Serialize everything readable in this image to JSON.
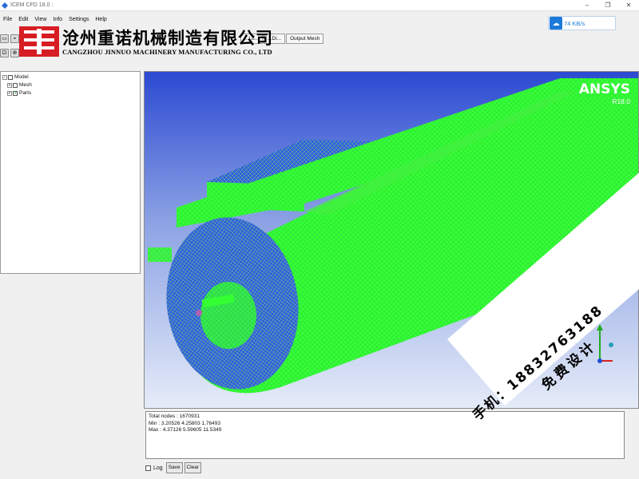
{
  "window": {
    "title": "ICEM CFD 18.0 :",
    "controls": [
      "–",
      "❐",
      "✕"
    ]
  },
  "menu": [
    "File",
    "Edit",
    "View",
    "Info",
    "Settings",
    "Help"
  ],
  "tabs": [
    "...Lo...",
    "...Di...",
    "Output Mesh"
  ],
  "logo": {
    "name_cn": "沧州重诺机械制造有限公司",
    "name_en": "CANGZHOU JINNUO MACHINERY MANUFACTURING CO., LTD"
  },
  "network": {
    "speed": "74 KB/s"
  },
  "tree": {
    "root": "Model",
    "items": [
      "Mesh",
      "Parts"
    ]
  },
  "viewport": {
    "brand": "ANSYS",
    "version": "R18.0",
    "mesh_color": "#33ff33",
    "background_top": "#2c4ad2",
    "background_bottom": "#e6ecf8"
  },
  "console": {
    "lines": [
      "Total nodes : 1670931",
      "Min : 3.20526 4.25803 1.76493",
      "Max : 4.37126 5.59605 11.5349"
    ],
    "log_label": "Log",
    "save_label": "Save",
    "clear_label": "Clear"
  },
  "watermark": {
    "phone": "手机：18832763188",
    "free": "免费设计"
  }
}
